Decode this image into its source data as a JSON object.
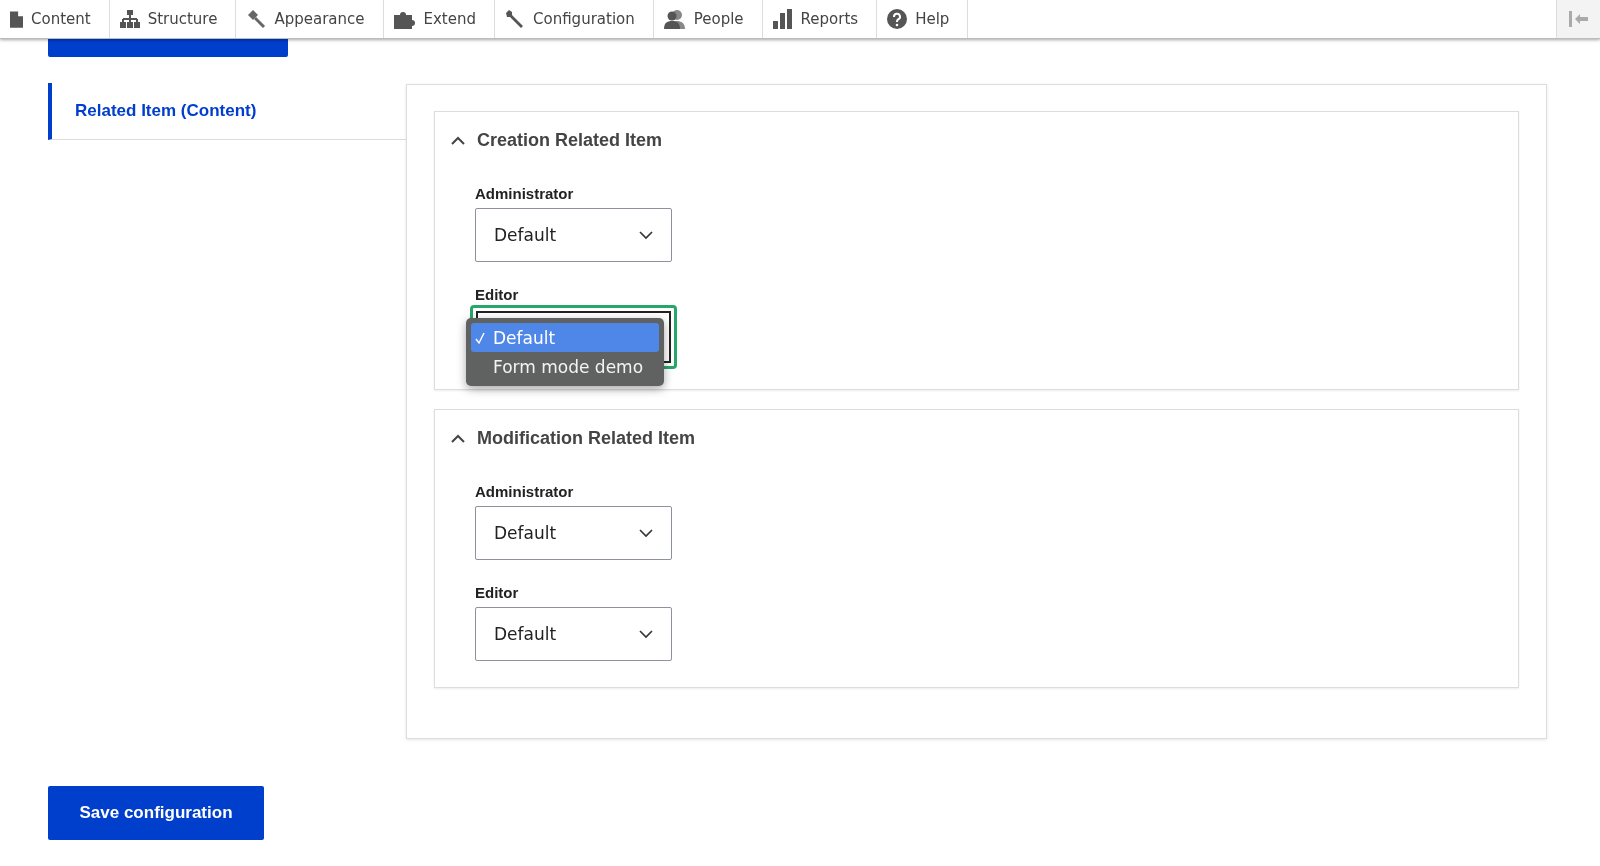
{
  "toolbar": {
    "items": [
      {
        "label": "Content",
        "kind": "content"
      },
      {
        "label": "Structure",
        "kind": "structure"
      },
      {
        "label": "Appearance",
        "kind": "appearance"
      },
      {
        "label": "Extend",
        "kind": "extend"
      },
      {
        "label": "Configuration",
        "kind": "configuration"
      },
      {
        "label": "People",
        "kind": "people"
      },
      {
        "label": "Reports",
        "kind": "reports"
      },
      {
        "label": "Help",
        "kind": "help"
      }
    ]
  },
  "vertical_tabs": [
    {
      "label": "Related Item (Content)",
      "selected": true
    }
  ],
  "sections": [
    {
      "title": "Creation Related Item",
      "expanded": true,
      "fields": [
        {
          "label": "Administrator",
          "value": "Default",
          "open": false
        },
        {
          "label": "Editor",
          "open": true,
          "options": [
            {
              "label": "Default",
              "selected": true
            },
            {
              "label": "Form mode demo",
              "selected": false
            }
          ]
        }
      ]
    },
    {
      "title": "Modification Related Item",
      "expanded": true,
      "fields": [
        {
          "label": "Administrator",
          "value": "Default",
          "open": false
        },
        {
          "label": "Editor",
          "value": "Default",
          "open": false
        }
      ]
    }
  ],
  "save_button": "Save configuration"
}
